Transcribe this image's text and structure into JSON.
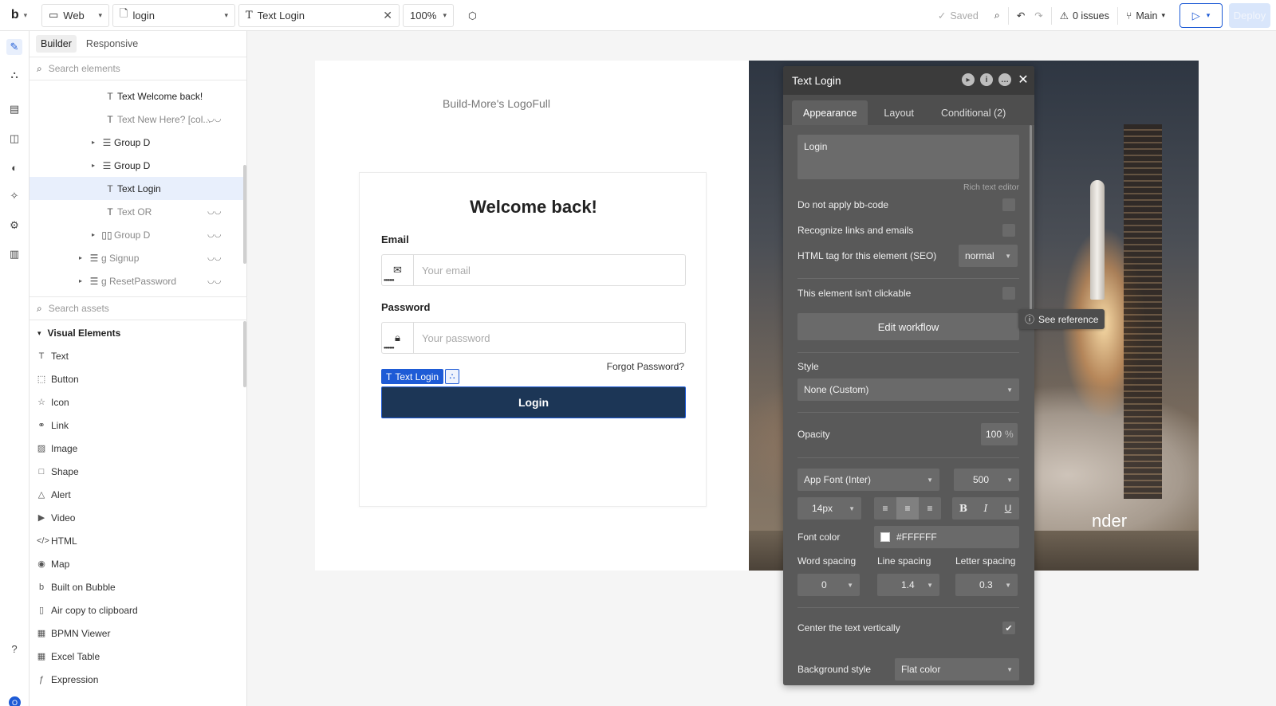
{
  "topbar": {
    "logo": "b",
    "platform": "Web",
    "page": "login",
    "element": "Text Login",
    "zoom": "100%",
    "saved": "Saved",
    "issues": "0 issues",
    "branch": "Main",
    "deploy": "Deploy"
  },
  "left": {
    "tabs": [
      "Builder",
      "Responsive"
    ],
    "search_placeholder": "Search elements",
    "tree": [
      {
        "label": "Text Welcome back!"
      },
      {
        "label": "Text New Here? [col..."
      },
      {
        "label": "Group D"
      },
      {
        "label": "Group D"
      },
      {
        "label": "Text Login"
      },
      {
        "label": "Text OR"
      },
      {
        "label": "Group D"
      },
      {
        "label": "g Signup"
      },
      {
        "label": "g ResetPassword"
      }
    ],
    "assets_placeholder": "Search assets",
    "category": "Visual Elements",
    "assets": [
      "Text",
      "Button",
      "Icon",
      "Link",
      "Image",
      "Shape",
      "Alert",
      "Video",
      "HTML",
      "Map",
      "Built on Bubble",
      "Air copy to clipboard",
      "BPMN Viewer",
      "Excel Table",
      "Expression"
    ],
    "avatar": "O"
  },
  "canvas": {
    "logo_text": "Build-More's LogoFull",
    "welcome": "Welcome back!",
    "email_label": "Email",
    "email_placeholder": "Your email",
    "password_label": "Password",
    "password_placeholder": "Your password",
    "forgot": "Forgot Password?",
    "selection_tag": "Text Login",
    "login_button": "Login",
    "hero_text": "nder"
  },
  "props": {
    "title": "Text Login",
    "tabs": [
      "Appearance",
      "Layout",
      "Conditional (2)"
    ],
    "content": "Login",
    "rich_text": "Rich text editor",
    "no_bbcode": "Do not apply bb-code",
    "recognize_links": "Recognize links and emails",
    "html_tag_label": "HTML tag for this element (SEO)",
    "html_tag_value": "normal",
    "not_clickable": "This element isn't clickable",
    "edit_workflow": "Edit workflow",
    "see_reference": "See reference",
    "style_label": "Style",
    "style_value": "None (Custom)",
    "opacity_label": "Opacity",
    "opacity_value": "100",
    "opacity_unit": "%",
    "font": "App Font (Inter)",
    "weight": "500",
    "size": "14px",
    "font_color_label": "Font color",
    "font_color_value": "#FFFFFF",
    "word_spacing_label": "Word spacing",
    "line_spacing_label": "Line spacing",
    "letter_spacing_label": "Letter spacing",
    "word_spacing": "0",
    "line_spacing": "1.4",
    "letter_spacing": "0.3",
    "center_vertically": "Center the text vertically",
    "bg_style_label": "Background style",
    "bg_style_value": "Flat color"
  },
  "colors": {
    "accent": "#1e5bd6",
    "button_bg": "#1c3656",
    "panel_bg": "#595959"
  }
}
